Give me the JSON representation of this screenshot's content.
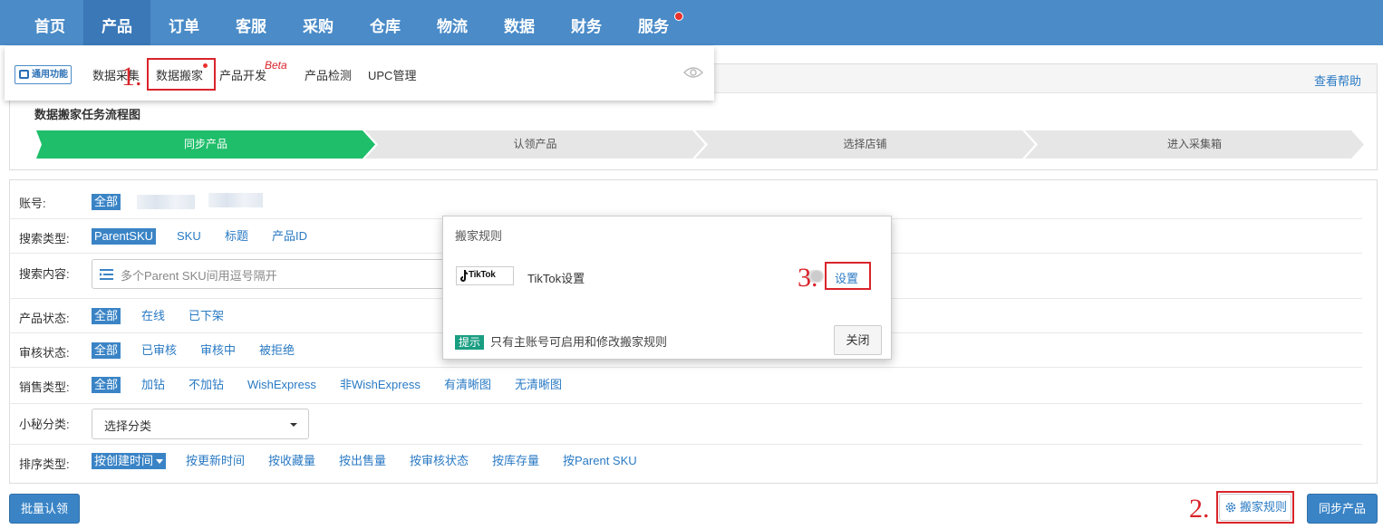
{
  "nav": {
    "items": [
      "首页",
      "产品",
      "订单",
      "客服",
      "采购",
      "仓库",
      "物流",
      "数据",
      "财务",
      "服务"
    ],
    "active": "产品"
  },
  "submenu": {
    "badge": "通用功能",
    "items": [
      "数据采集",
      "数据搬家",
      "产品开发",
      "产品检测",
      "UPC管理"
    ],
    "beta": "Beta"
  },
  "annotations": {
    "step1": "1.",
    "step2": "2.",
    "step3": "3."
  },
  "flow": {
    "help": "查看帮助",
    "title": "数据搬家任务流程图",
    "steps": [
      "同步产品",
      "认领产品",
      "选择店铺",
      "进入采集箱"
    ]
  },
  "filters": {
    "account": {
      "label": "账号:",
      "options": [
        "全部"
      ]
    },
    "search_type": {
      "label": "搜索类型:",
      "options": [
        "ParentSKU",
        "SKU",
        "标题",
        "产品ID"
      ]
    },
    "search_content": {
      "label": "搜索内容:",
      "placeholder": "多个Parent SKU间用逗号隔开"
    },
    "product_status": {
      "label": "产品状态:",
      "options": [
        "全部",
        "在线",
        "已下架"
      ]
    },
    "review_status": {
      "label": "审核状态:",
      "options": [
        "全部",
        "已审核",
        "审核中",
        "被拒绝"
      ]
    },
    "sales_type": {
      "label": "销售类型:",
      "options": [
        "全部",
        "加钻",
        "不加钻",
        "WishExpress",
        "非WishExpress",
        "有清晰图",
        "无清晰图"
      ]
    },
    "category": {
      "label": "小秘分类:",
      "value": "选择分类"
    },
    "sort_type": {
      "label": "排序类型:",
      "options": [
        "按创建时间",
        "按更新时间",
        "按收藏量",
        "按出售量",
        "按审核状态",
        "按库存量",
        "按Parent SKU"
      ]
    }
  },
  "buttons": {
    "batch_claim": "批量认领",
    "move_rules": "搬家规则",
    "sync": "同步产品"
  },
  "modal": {
    "title": "搬家规则",
    "logo_text": "TikTok",
    "platform_label": "TikTok设置",
    "settings": "设置",
    "tip_badge": "提示",
    "tip_text": "只有主账号可启用和修改搬家规则",
    "close": "关闭"
  },
  "colors": {
    "nav_bg": "#4a8bc8",
    "accent": "#2a7ac4",
    "step_active": "#1fbe6a",
    "step_inactive": "#e6e6e6",
    "highlight": "#d9242a"
  }
}
